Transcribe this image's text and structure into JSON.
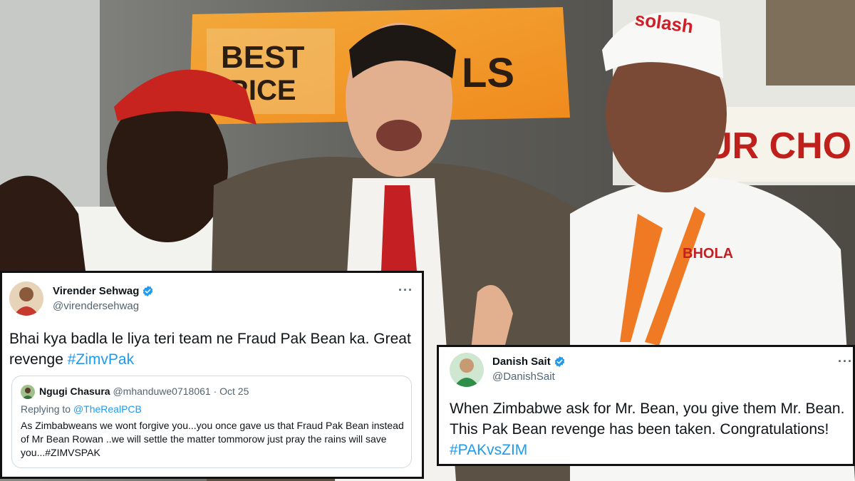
{
  "background": {
    "sign_text": "BEST",
    "sign_text_2": "RICE",
    "sign_text_3": "LS",
    "banner_text": "UR CHO",
    "cap_brand": "solash",
    "shirt_brand": "BHOLA"
  },
  "tweets": [
    {
      "author_name": "Virender Sehwag",
      "author_handle": "@virendersehwag",
      "more_label": "···",
      "text_main": "Bhai kya badla le liya teri team ne Fraud Pak Bean ka. Great revenge ",
      "hashtag": "#ZimvPak",
      "quoted": {
        "author_name": "Ngugi Chasura",
        "author_handle": "@mhanduwe0718061",
        "date": "· Oct 25",
        "replying_prefix": "Replying to ",
        "replying_to": "@TheRealPCB",
        "text": "As Zimbabweans we wont forgive you...you once gave us that Fraud Pak Bean instead of Mr Bean Rowan ..we will settle the matter tommorow just pray the rains will save you...#ZIMVSPAK"
      }
    },
    {
      "author_name": "Danish Sait",
      "author_handle": "@DanishSait",
      "more_label": "···",
      "text_main": "When Zimbabwe ask for Mr. Bean, you give them Mr. Bean. This Pak Bean revenge has been taken. Congratulations! ",
      "hashtag": "#PAKvsZIM"
    }
  ],
  "colors": {
    "link": "#1d9bf0",
    "verified": "#1d9bf0",
    "secondary_text": "#536471"
  }
}
